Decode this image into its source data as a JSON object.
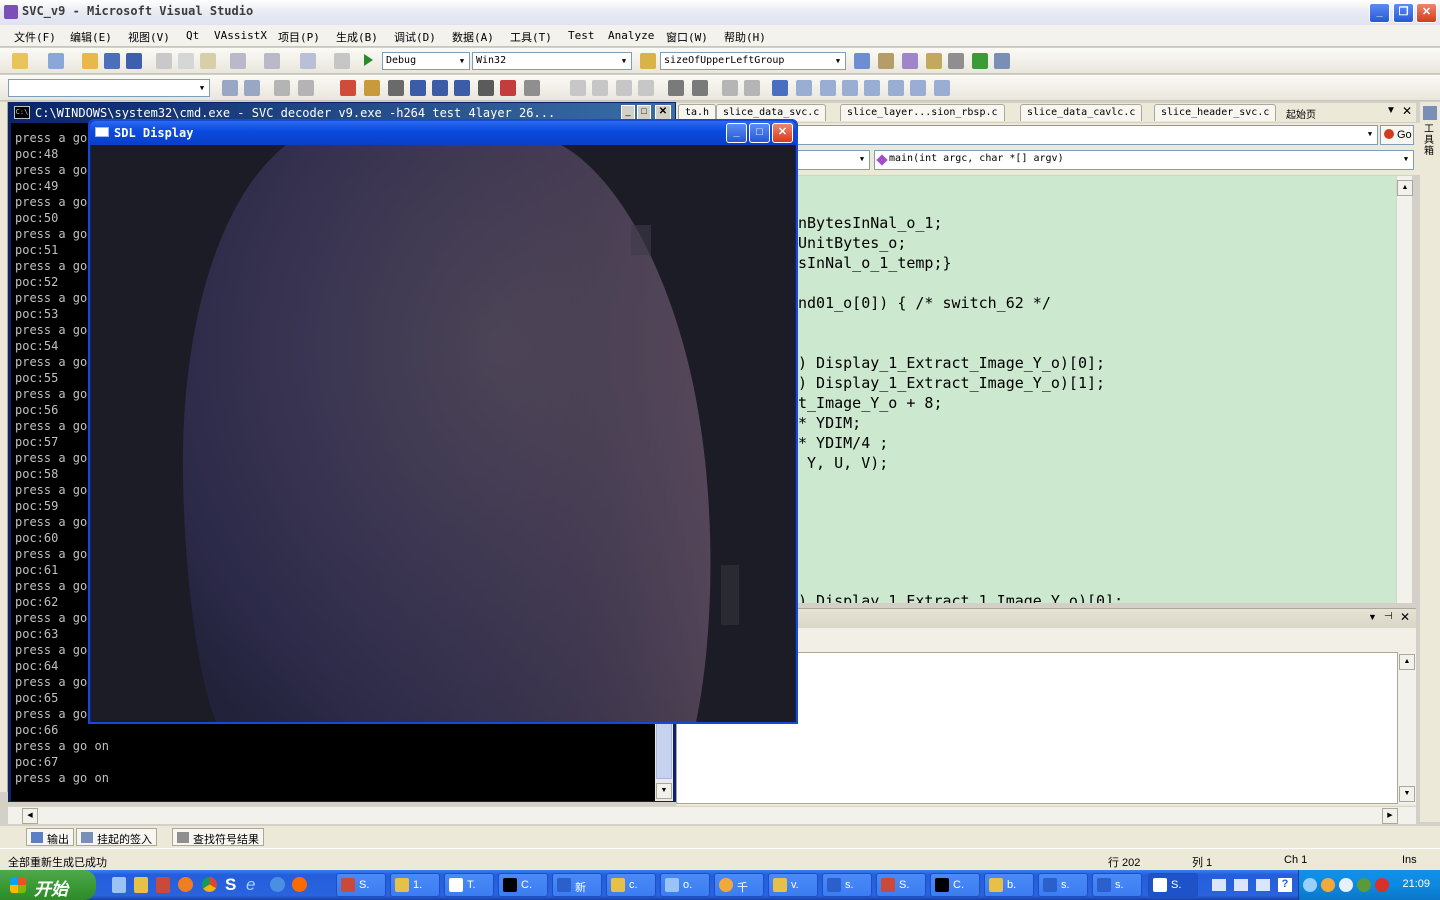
{
  "vs": {
    "title": "SVC_v9 - Microsoft Visual Studio",
    "menu": [
      "文件(F)",
      "编辑(E)",
      "视图(V)",
      "Qt",
      "VAssistX",
      "项目(P)",
      "生成(B)",
      "调试(D)",
      "数据(A)",
      "工具(T)",
      "Test",
      "Analyze",
      "窗口(W)",
      "帮助(H)"
    ],
    "config_combo": "Debug",
    "platform_combo": "Win32",
    "find_combo": "sizeOfUpperLeftGroup",
    "tabs": [
      "ta.h",
      "slice_data_svc.c",
      "slice_layer...sion_rbsp.c",
      "slice_data_cavlc.c",
      "slice_header_svc.c",
      "起始页"
    ],
    "func_combo": "main(int argc, char *[] argv)",
    "go_label": "Go",
    "code_lines": [
      "nBytesInNal_o_1;",
      "UnitBytes_o;",
      "sInNal_o_1_temp;}",
      "",
      "nd01_o[0]) { /* switch_62 */",
      "",
      "",
      ") Display_1_Extract_Image_Y_o)[0];",
      ") Display_1_Extract_Image_Y_o)[1];",
      "t_Image_Y_o + 8;",
      "* YDIM;",
      "* YDIM/4 ;",
      " Y, U, V);",
      "",
      "",
      "",
      "",
      "",
      "",
      ") Display_1_Extract_1_Image_Y_o)[0];"
    ],
    "side_label": "工具箱",
    "bottom_tabs": [
      "输出",
      "挂起的签入",
      "查找符号结果"
    ],
    "status": {
      "message": "全部重新生成已成功",
      "line": "行 202",
      "col": "列 1",
      "ch": "Ch 1",
      "mode": "Ins"
    }
  },
  "cmd": {
    "title": "C:\\WINDOWS\\system32\\cmd.exe - SVC_decoder_v9.exe -h264 test_4layer_26...",
    "lines": [
      "press a go on",
      "poc:48",
      "press a go on",
      "poc:49",
      "press a go on",
      "poc:50",
      "press a go on",
      "poc:51",
      "press a go on",
      "poc:52",
      "press a go on",
      "poc:53",
      "press a go on",
      "poc:54",
      "press a go on",
      "poc:55",
      "press a go on",
      "poc:56",
      "press a go on",
      "poc:57",
      "press a go on",
      "poc:58",
      "press a go on",
      "poc:59",
      "press a go on",
      "poc:60",
      "press a go on",
      "poc:61",
      "press a go on",
      "poc:62",
      "press a go on",
      "poc:63",
      "press a go on",
      "poc:64",
      "press a go on",
      "poc:65",
      "press a go on",
      "poc:66",
      "press a go on",
      "poc:67",
      "press a go on"
    ]
  },
  "sdl": {
    "title": "SDL Display"
  },
  "taskbar": {
    "start_label": "开始",
    "tasks": [
      "S.",
      "1.",
      "T.",
      "C.",
      "新",
      "c.",
      "o.",
      "千",
      "v.",
      "s.",
      "S.",
      "C.",
      "b.",
      "s.",
      "s.",
      "S."
    ],
    "clock": "21:09"
  },
  "colors": {
    "code_bg": "#cce8cf",
    "cmd_bg": "#000000",
    "title_blue": "#0a246a",
    "taskbar_blue": "#245edb"
  }
}
